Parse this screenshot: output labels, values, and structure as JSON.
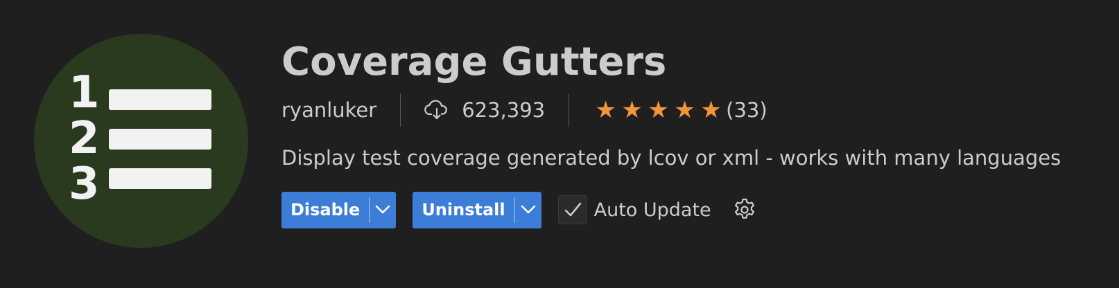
{
  "extension": {
    "name": "Coverage Gutters",
    "publisher": "ryanluker",
    "install_count": "623,393",
    "rating_stars": 5,
    "rating_count": "(33)",
    "description": "Display test coverage generated by lcov or xml - works with many languages"
  },
  "logo": {
    "background_color": "#2a3a1e",
    "digits": [
      "1",
      "2",
      "3"
    ]
  },
  "actions": {
    "disable_label": "Disable",
    "uninstall_label": "Uninstall",
    "auto_update_label": "Auto Update",
    "auto_update_checked": true
  },
  "icons": {
    "download": "cloud-download-icon",
    "dropdown": "chevron-down-icon",
    "check": "check-icon",
    "settings": "gear-icon",
    "star": "star-icon"
  },
  "colors": {
    "background": "#1f1f1f",
    "button": "#3c7dd8",
    "star": "#f0953a",
    "text": "#cccccc"
  }
}
